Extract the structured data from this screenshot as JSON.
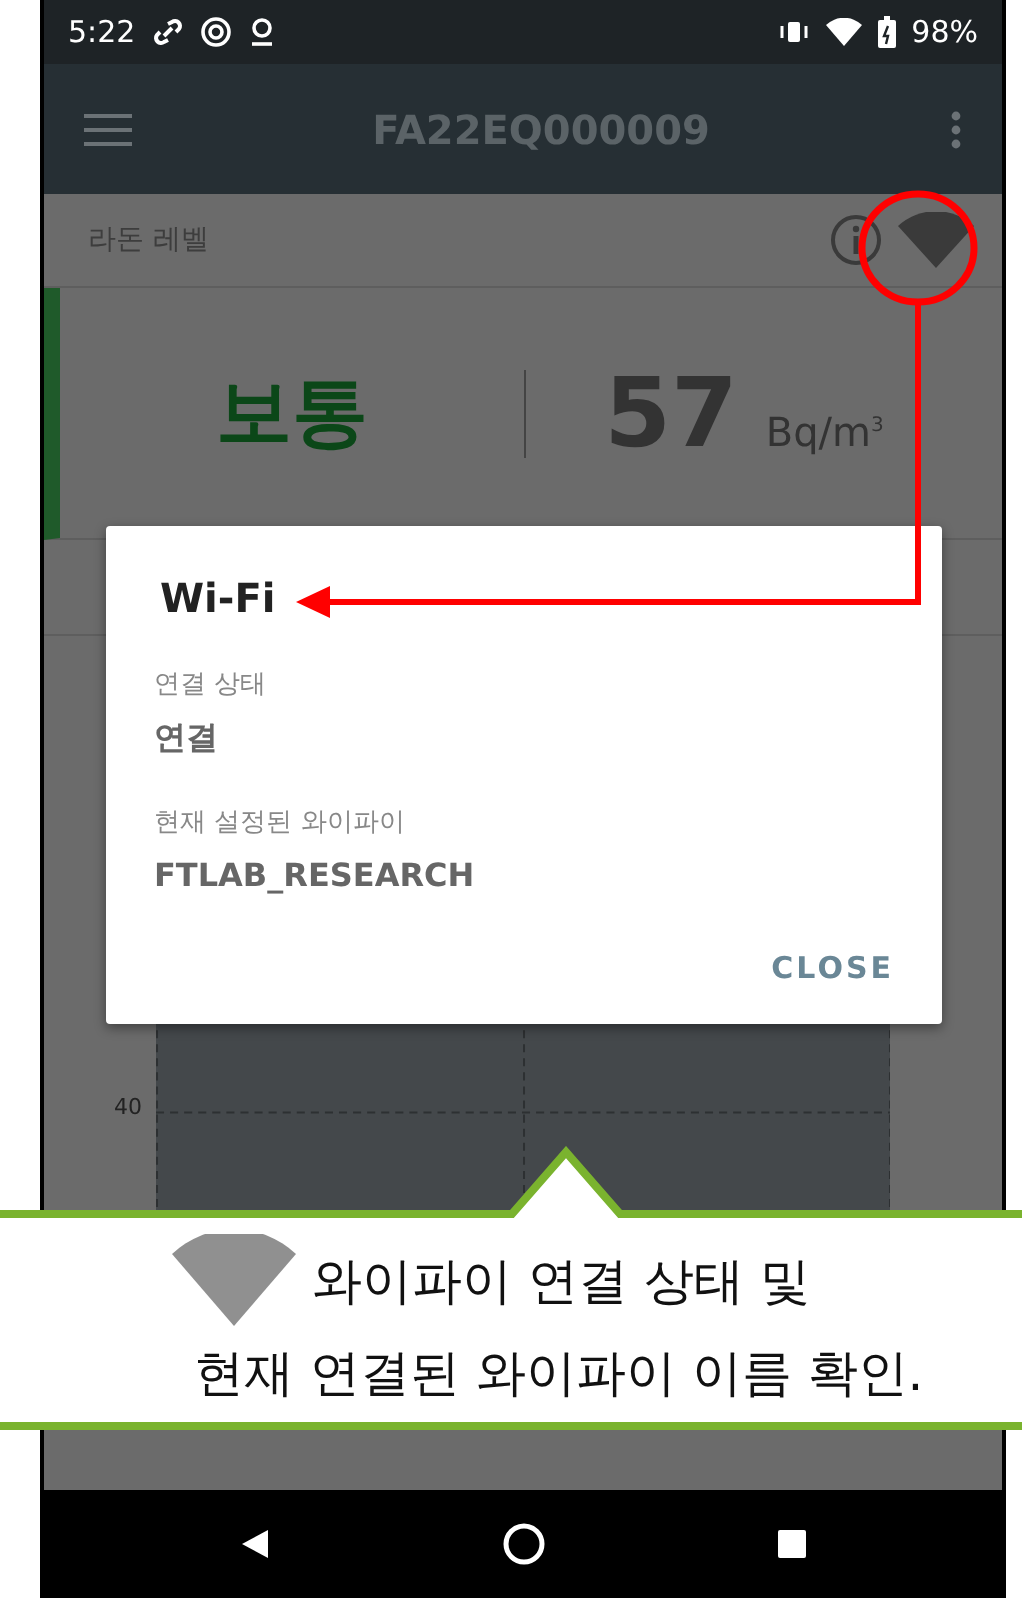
{
  "status_bar": {
    "time": "5:22",
    "battery": "98%"
  },
  "app_bar": {
    "title": "FA22EQ000009"
  },
  "radon": {
    "label": "라돈 레벨",
    "level_text": "보통",
    "value": "57",
    "unit": "Bq/m$^{3}$"
  },
  "chart": {
    "y_tick": "40"
  },
  "dialog": {
    "title": "Wi-Fi",
    "fields": [
      {
        "label": "연결 상태",
        "value": "연결"
      },
      {
        "label": "현재 설정된 와이파이",
        "value": "FTLAB_RESEARCH"
      }
    ],
    "button": "CLOSE"
  },
  "callout": {
    "lines": [
      "와이파이 연결 상태 및",
      "현재 연결된 와이파이 이름 확인."
    ]
  }
}
